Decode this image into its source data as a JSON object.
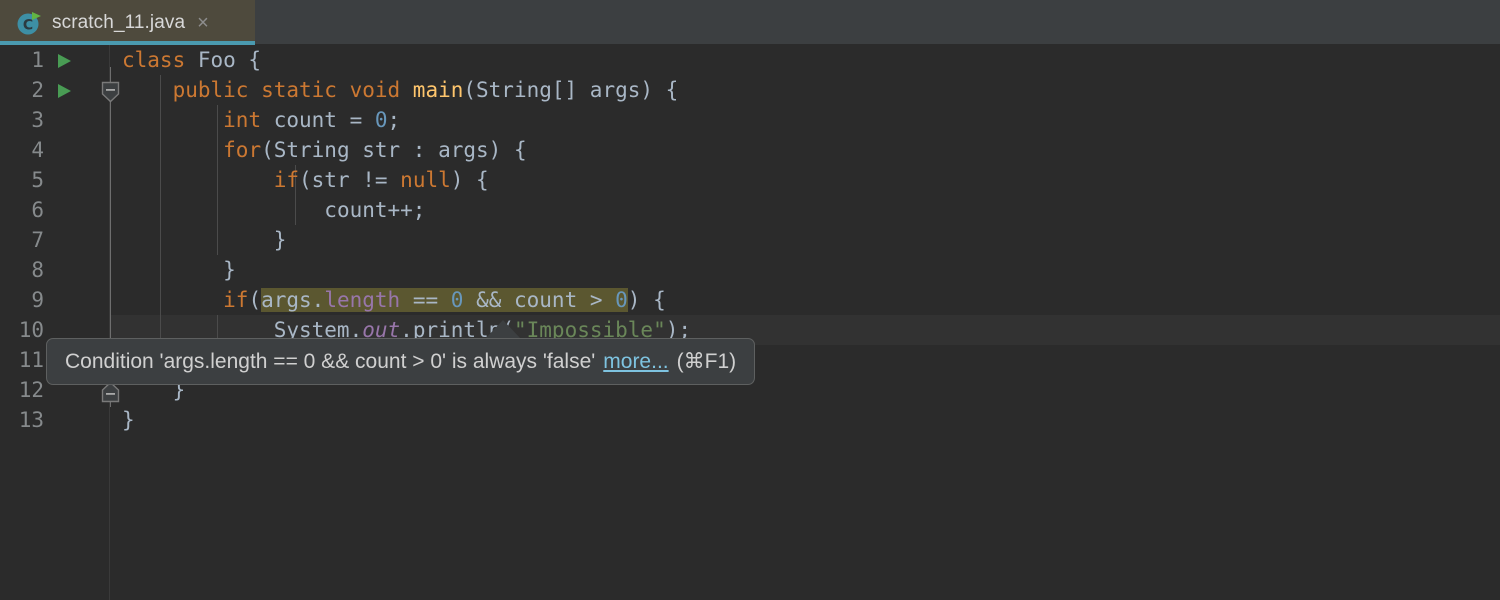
{
  "window": {
    "background": "#2b2b2b",
    "tabbar_background": "#3c3f41"
  },
  "tabbar": {
    "active_tab": {
      "label": "scratch_11.java",
      "icon": "java-scratch-file-icon",
      "close_icon": "×",
      "underline_color": "#4a9ab0",
      "background": "#4e4a3d"
    }
  },
  "editor": {
    "language": "java",
    "caret_line": 10,
    "colors": {
      "keyword": "#cc7832",
      "number": "#6897bb",
      "method": "#ffc66d",
      "field": "#9876aa",
      "string": "#6a8759",
      "text": "#a9b7c6",
      "line_number": "#868a8c",
      "run_marker": "#499c54",
      "warning_highlight": "#5b5730"
    },
    "lines": [
      {
        "n": "1",
        "run_marker": true,
        "fold": "none"
      },
      {
        "n": "2",
        "run_marker": true,
        "fold": "open"
      },
      {
        "n": "3",
        "run_marker": false,
        "fold": "none"
      },
      {
        "n": "4",
        "run_marker": false,
        "fold": "none"
      },
      {
        "n": "5",
        "run_marker": false,
        "fold": "none"
      },
      {
        "n": "6",
        "run_marker": false,
        "fold": "none"
      },
      {
        "n": "7",
        "run_marker": false,
        "fold": "none"
      },
      {
        "n": "8",
        "run_marker": false,
        "fold": "none"
      },
      {
        "n": "9",
        "run_marker": false,
        "fold": "none"
      },
      {
        "n": "10",
        "run_marker": false,
        "fold": "none"
      },
      {
        "n": "11",
        "run_marker": false,
        "fold": "none"
      },
      {
        "n": "12",
        "run_marker": false,
        "fold": "close"
      },
      {
        "n": "13",
        "run_marker": false,
        "fold": "none"
      }
    ],
    "source": {
      "line1": "class Foo {",
      "line2": "    public static void main(String[] args) {",
      "line3": "        int count = 0;",
      "line4": "        for(String str : args) {",
      "line5": "            if(str != null) {",
      "line6": "                count++;",
      "line7": "            }",
      "line8": "        }",
      "line9": "        if(args.length == 0 && count > 0) {",
      "line10": "            System.out.println(\"Impossible\");",
      "line11": "        }",
      "line12": "    }",
      "line13": "}"
    },
    "tokens": {
      "l1_kw_class": "class",
      "l1_name": " Foo {",
      "l2_kw": "public static void ",
      "l2_fn": "main",
      "l2_rest": "(String[] args) {",
      "l3_kw": "int",
      "l3_mid": " count = ",
      "l3_num": "0",
      "l3_end": ";",
      "l4_kw": "for",
      "l4_rest": "(String str : args) {",
      "l5_kw": "if",
      "l5_mid": "(str != ",
      "l5_kw2": "null",
      "l5_end": ") {",
      "l6_text": "count++;",
      "l7_text": "}",
      "l8_text": "}",
      "l9_kw": "if",
      "l9_open": "(",
      "l9_args": "args.",
      "l9_length": "length",
      "l9_eq": " == ",
      "l9_zero1": "0",
      "l9_amp": " && count > ",
      "l9_zero2": "0",
      "l9_close": ") {",
      "l10_system": "System.",
      "l10_out": "out",
      "l10_dot": ".",
      "l10_println": "println",
      "l10_paren": "(",
      "l10_str": "\"Impossible\"",
      "l10_end": ");",
      "l11_text": "}",
      "l12_text": "}",
      "l13_text": "}"
    }
  },
  "tooltip": {
    "prefix": "Condition 'args.length == 0 && count > 0' is always 'false'",
    "more_label": "more...",
    "shortcut": "(⌘F1)",
    "background": "#3c3f41",
    "link_color": "#7ec3e0"
  }
}
